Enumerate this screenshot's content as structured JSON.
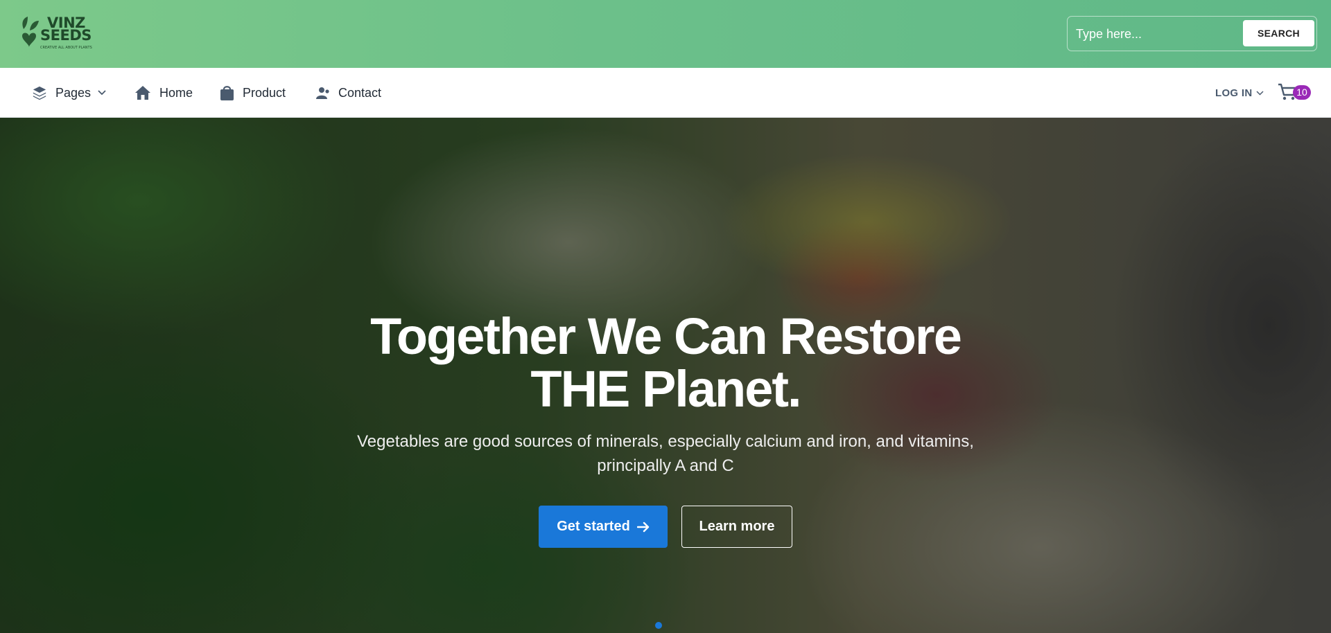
{
  "brand": {
    "logo_line1": "VINZ",
    "logo_line2": "SEEDS",
    "tagline": "CREATIVE ALL ABOUT PLANTS"
  },
  "search": {
    "placeholder": "Type here...",
    "button_label": "SEARCH"
  },
  "nav": {
    "items": [
      {
        "label": "Pages",
        "icon": "layers-icon",
        "has_dropdown": true
      },
      {
        "label": "Home",
        "icon": "home-icon"
      },
      {
        "label": "Product",
        "icon": "shopping-bag-icon"
      },
      {
        "label": "Contact",
        "icon": "contact-icon"
      }
    ],
    "login_label": "LOG IN",
    "cart_count": "10"
  },
  "hero": {
    "title_line1": "Together We Can Restore",
    "title_line2": "THE Planet.",
    "subtitle": "Vegetables are good sources of minerals, especially calcium and iron, and vitamins, principally A and C",
    "primary_button": "Get started",
    "secondary_button": "Learn more"
  },
  "colors": {
    "header_green": "#6cc08a",
    "primary_blue": "#1a78d9",
    "badge_purple": "#9a29b7"
  }
}
